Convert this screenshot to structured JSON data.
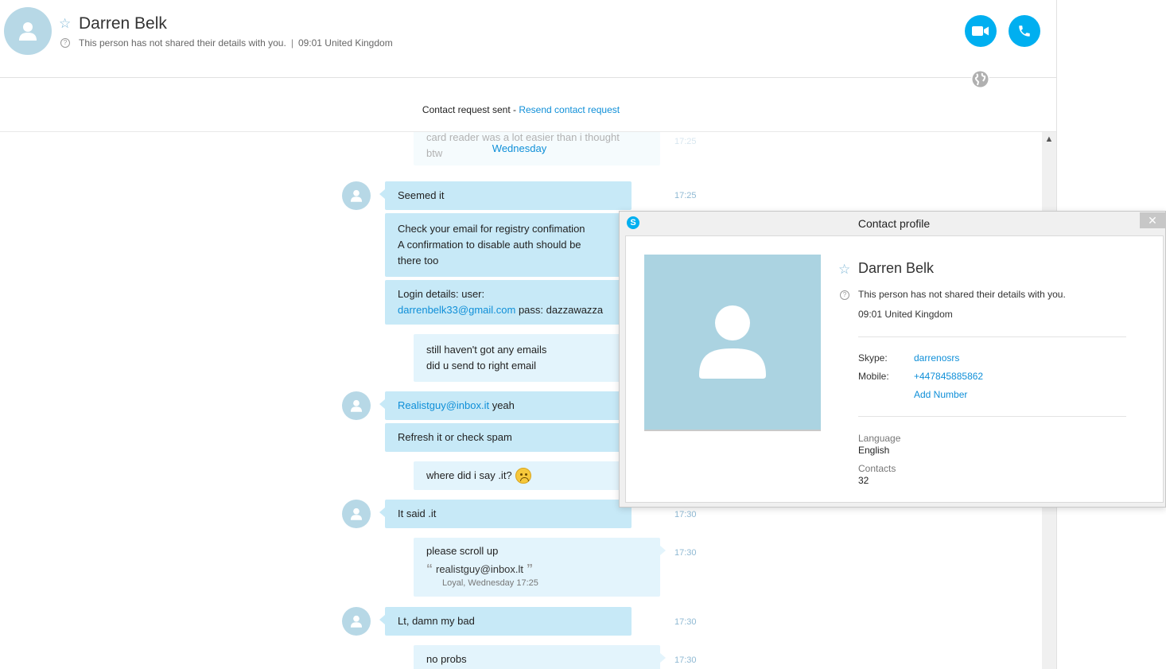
{
  "header": {
    "contact_name": "Darren Belk",
    "status_note": "This person has not shared their details with you.",
    "separator": "|",
    "local_time": "09:01 United Kingdom",
    "icons": [
      "avatar-icon",
      "star-icon",
      "question-icon",
      "video-call-icon",
      "audio-call-icon",
      "globe-icon"
    ]
  },
  "request_bar": {
    "text": "Contact request sent - ",
    "link": "Resend contact request"
  },
  "chat": {
    "day_label": "Wednesday",
    "faded_message_line1": "card reader was a lot easier than i thought",
    "faded_message_line2": "btw",
    "faded_time": "17:25",
    "messages": [
      {
        "text": "Seemed it",
        "time": "17:25"
      },
      {
        "line1": "Check your email for registry confimation",
        "line2": "A confirmation to disable auth should be",
        "line3": "there too"
      },
      {
        "line1": "Login details: user:",
        "email": "darrenbelk33@gmail.com",
        "rest": " pass: dazzawazza"
      },
      {
        "line1": "still haven't got any emails",
        "line2": "did u send to right email"
      },
      {
        "email": "Realistguy@inbox.it",
        "rest": " yeah"
      },
      {
        "text": "Refresh it or check spam"
      },
      {
        "text": "where did i say .it?"
      },
      {
        "text": "It said .it",
        "time": "17:30"
      },
      {
        "text": "please scroll up",
        "quote": "realistguy@inbox.lt",
        "quote_meta": "Loyal, Wednesday 17:25",
        "time": "17:30"
      },
      {
        "text": "Lt, damn my bad",
        "time": "17:30"
      },
      {
        "text": "no probs",
        "time": "17:30"
      }
    ]
  },
  "profile": {
    "title": "Contact profile",
    "close": "✕",
    "name": "Darren Belk",
    "status_note": "This person has not shared their details with you.",
    "local_time": "09:01 United Kingdom",
    "skype_label": "Skype:",
    "skype_value": "darrenosrs",
    "mobile_label": "Mobile:",
    "mobile_value": "+447845885862",
    "add_number": "Add Number",
    "language_label": "Language",
    "language_value": "English",
    "contacts_label": "Contacts",
    "contacts_value": "32"
  },
  "colors": {
    "accent": "#00aff0",
    "link": "#0f8fd8",
    "their_bubble": "#c7e9f7",
    "my_bubble": "#e3f4fc",
    "avatar": "#b7d8e6"
  }
}
